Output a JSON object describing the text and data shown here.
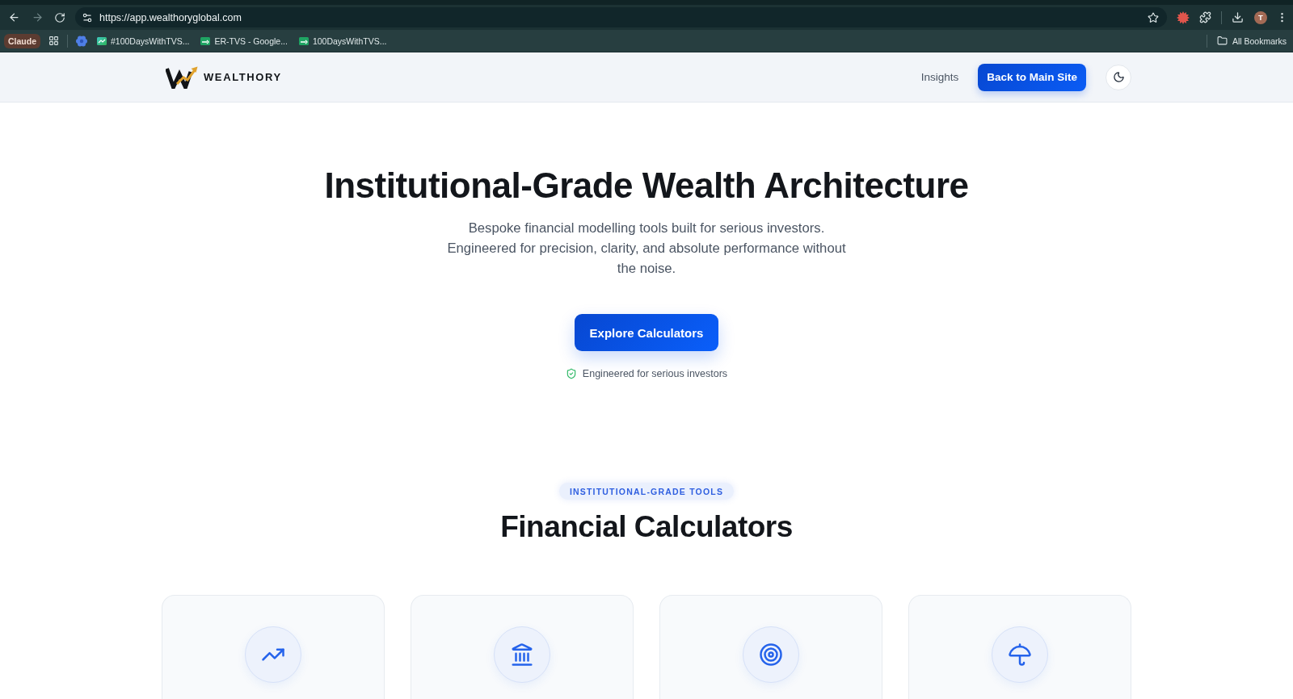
{
  "browser": {
    "url": "https://app.wealthoryglobal.com",
    "profile_initial": "T",
    "pinned_chip": "Claude",
    "bookmarks": [
      {
        "kind": "favicon"
      },
      {
        "kind": "page",
        "label": "#100DaysWithTVS..."
      },
      {
        "kind": "sheet",
        "label": "ER-TVS - Google..."
      },
      {
        "kind": "sheet",
        "label": "100DaysWithTVS..."
      }
    ],
    "all_bookmarks": "All Bookmarks"
  },
  "nav": {
    "brand": "WEALTHORY",
    "links": [
      "Insights"
    ],
    "cta": "Back to Main Site"
  },
  "hero": {
    "title": "Institutional-Grade Wealth Architecture",
    "subtitle": "Bespoke financial modelling tools built for serious investors. Engineered for precision, clarity, and absolute performance without the noise.",
    "button": "Explore Calculators",
    "trust_note": "Engineered for serious investors"
  },
  "calculators": {
    "eyebrow": "INSTITUTIONAL-GRADE TOOLS",
    "heading": "Financial Calculators",
    "cards": [
      {
        "kind": "growth"
      },
      {
        "kind": "bank"
      },
      {
        "kind": "target"
      },
      {
        "kind": "umbrella"
      }
    ]
  }
}
